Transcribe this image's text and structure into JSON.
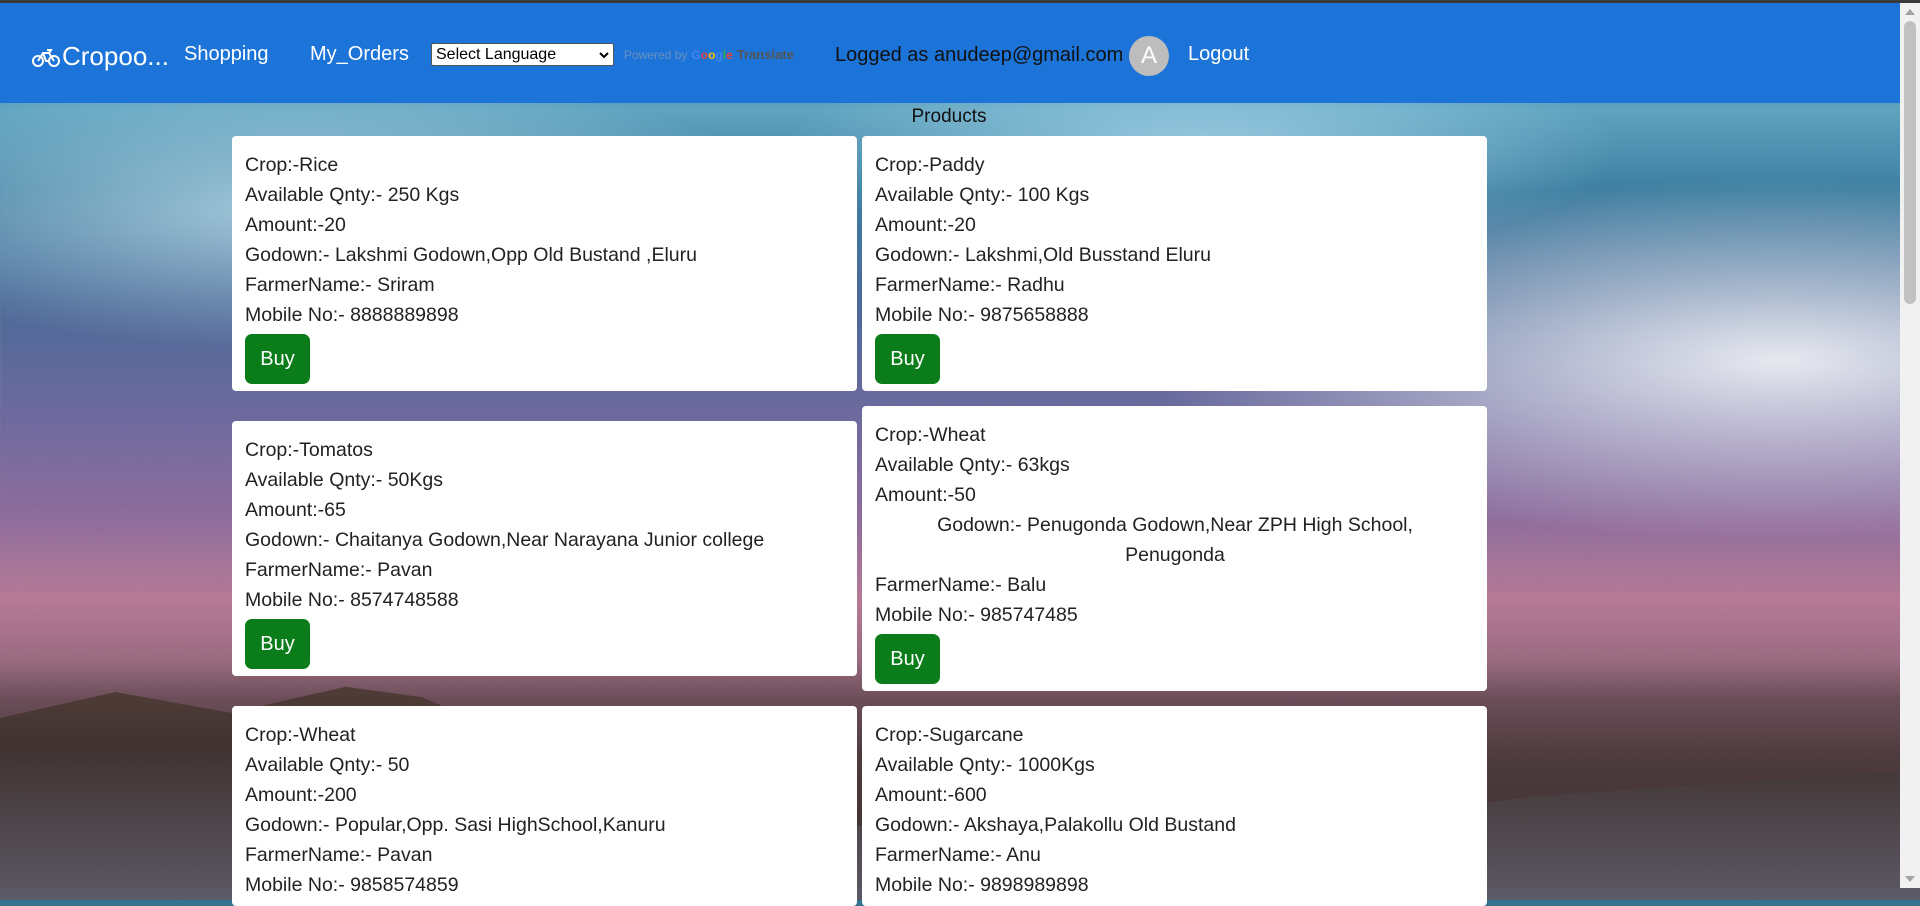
{
  "brand": {
    "icon": "motorcycle-icon",
    "label": "Cropoo..."
  },
  "nav": {
    "shopping": "Shopping",
    "my_orders": "My_Orders",
    "logout": "Logout"
  },
  "language": {
    "selected": "Select Language",
    "powered_by": "Powered by",
    "google": "Google",
    "translate": "Translate"
  },
  "user": {
    "logged_text": "Logged as anudeep@gmail.com",
    "avatar_letter": "A"
  },
  "page": {
    "title": "Products",
    "buy_label": "Buy"
  },
  "products": [
    {
      "crop": "Crop:-Rice",
      "qty": "Available Qnty:- 250 Kgs",
      "amount": "Amount:-20",
      "godown": "Godown:- Lakshmi Godown,Opp Old Bustand ,Eluru",
      "farmer": "FarmerName:- Sriram",
      "mobile": "Mobile No:- 8888889898"
    },
    {
      "crop": "Crop:-Paddy",
      "qty": "Available Qnty:- 100 Kgs",
      "amount": "Amount:-20",
      "godown": "Godown:- Lakshmi,Old Busstand Eluru",
      "farmer": "FarmerName:- Radhu",
      "mobile": "Mobile No:- 9875658888"
    },
    {
      "crop": "Crop:-Tomatos",
      "qty": "Available Qnty:- 50Kgs",
      "amount": "Amount:-65",
      "godown": "Godown:- Chaitanya Godown,Near Narayana Junior college",
      "farmer": "FarmerName:- Pavan",
      "mobile": "Mobile No:- 8574748588"
    },
    {
      "crop": "Crop:-Wheat",
      "qty": "Available Qnty:- 63kgs",
      "amount": "Amount:-50",
      "godown": "Godown:- Penugonda Godown,Near ZPH High School, Penugonda",
      "farmer": "FarmerName:- Balu",
      "mobile": "Mobile No:- 985747485"
    },
    {
      "crop": "Crop:-Wheat",
      "qty": "Available Qnty:- 50",
      "amount": "Amount:-200",
      "godown": "Godown:- Popular,Opp. Sasi HighSchool,Kanuru",
      "farmer": "FarmerName:- Pavan",
      "mobile": "Mobile No:- 9858574859"
    },
    {
      "crop": "Crop:-Sugarcane",
      "qty": "Available Qnty:- 1000Kgs",
      "amount": "Amount:-600",
      "godown": "Godown:- Akshaya,Palakollu Old Bustand",
      "farmer": "FarmerName:- Anu",
      "mobile": "Mobile No:- 9898989898"
    }
  ]
}
